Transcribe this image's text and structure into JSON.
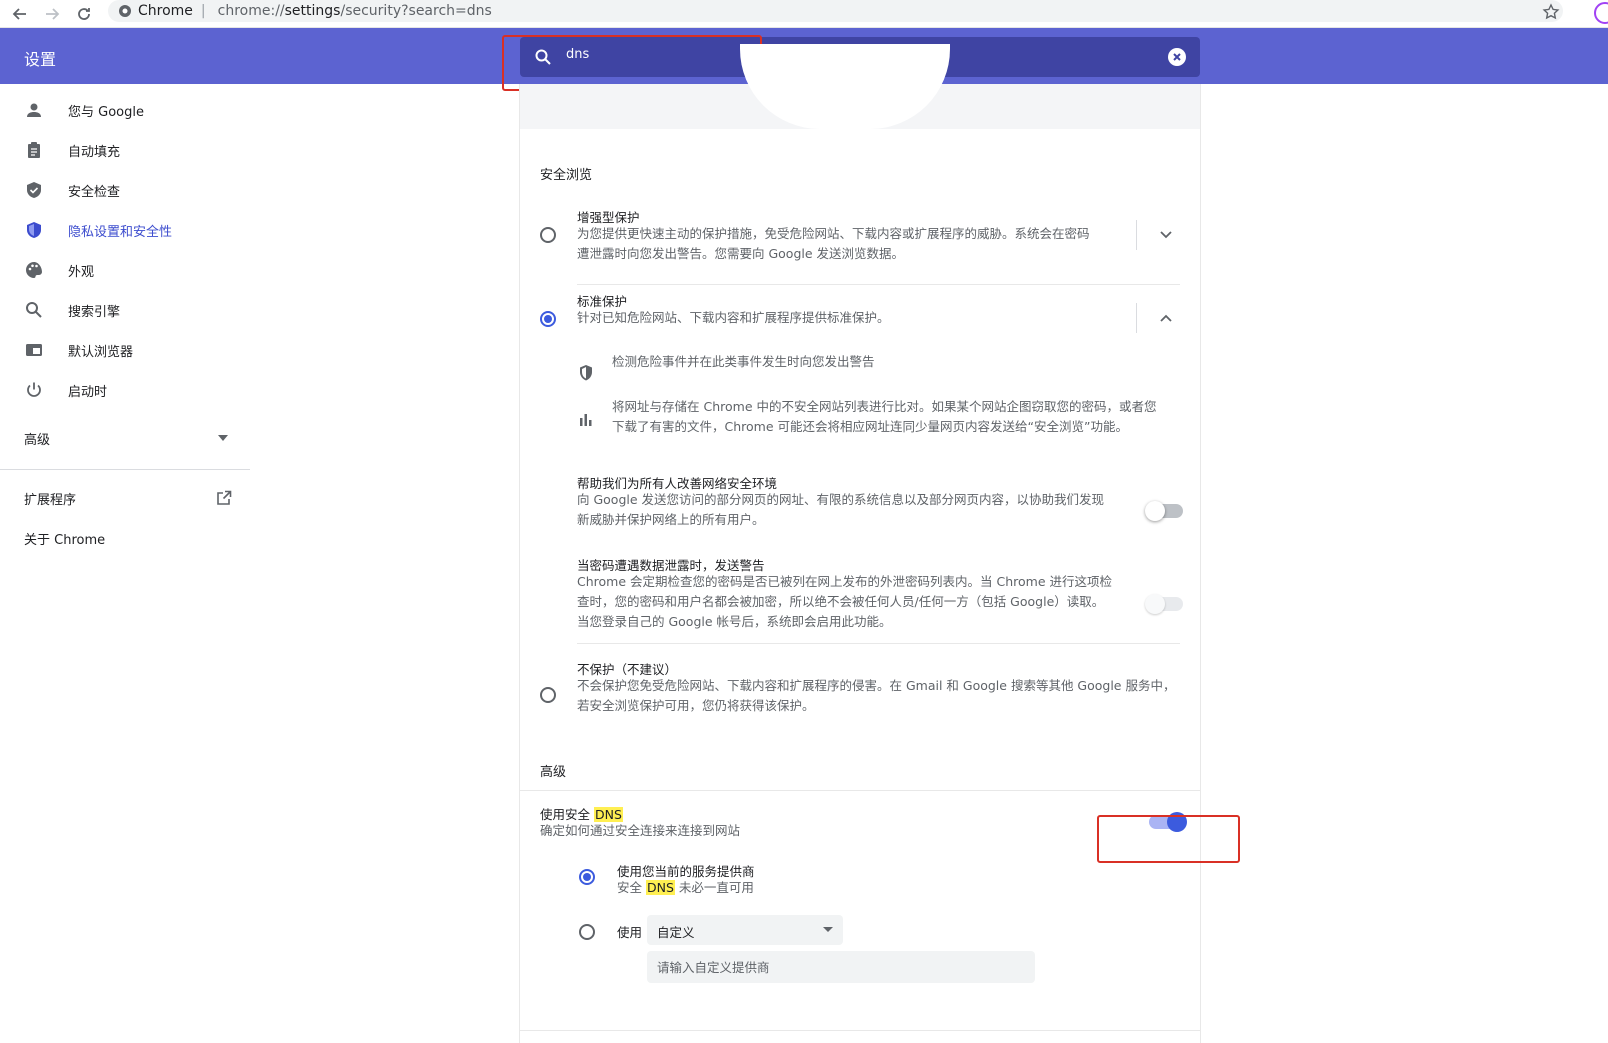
{
  "browser": {
    "site_label": "Chrome",
    "separator": "|",
    "url_prefix": "chrome://",
    "url_bold": "settings",
    "url_suffix": "/security?search=dns"
  },
  "header": {
    "title": "设置",
    "search_value": "dns"
  },
  "sidebar": {
    "items": [
      {
        "label": "您与 Google",
        "icon": "person-icon"
      },
      {
        "label": "自动填充",
        "icon": "clipboard-icon"
      },
      {
        "label": "安全检查",
        "icon": "shield-check-icon"
      },
      {
        "label": "隐私设置和安全性",
        "icon": "shield-privacy-icon",
        "active": true
      },
      {
        "label": "外观",
        "icon": "palette-icon"
      },
      {
        "label": "搜索引擎",
        "icon": "search-icon"
      },
      {
        "label": "默认浏览器",
        "icon": "browser-icon"
      },
      {
        "label": "启动时",
        "icon": "power-icon"
      }
    ],
    "advanced_label": "高级",
    "extensions_label": "扩展程序",
    "about_label": "关于 Chrome"
  },
  "safe_browsing": {
    "section_title": "安全浏览",
    "enhanced": {
      "title": "增强型保护",
      "desc_line1": "为您提供更快速主动的保护措施，免受危险网站、下载内容或扩展程序的威胁。系统会在密码",
      "desc_line2": "遭泄露时向您发出警告。您需要向 Google 发送浏览数据。"
    },
    "standard": {
      "title": "标准保护",
      "desc": "针对已知危险网站、下载内容和扩展程序提供标准保护。",
      "feature1": "检测危险事件并在此类事件发生时向您发出警告",
      "feature2_line1": "将网址与存储在 Chrome 中的不安全网站列表进行比对。如果某个网站企图窃取您的密码，或者您",
      "feature2_line2": "下载了有害的文件，Chrome 可能还会将相应网址连同少量网页内容发送给“安全浏览”功能。"
    },
    "help_improve": {
      "title": "帮助我们为所有人改善网络安全环境",
      "desc_line1": "向 Google 发送您访问的部分网页的网址、有限的系统信息以及部分网页内容，以协助我们发现",
      "desc_line2": "新威胁并保护网络上的所有用户。"
    },
    "password_warn": {
      "title": "当密码遭遇数据泄露时，发送警告",
      "desc_line1": "Chrome 会定期检查您的密码是否已被列在网上发布的外泄密码列表内。当 Chrome 进行这项检",
      "desc_line2": "查时，您的密码和用户名都会被加密，所以绝不会被任何人员/任何一方（包括 Google）读取。",
      "desc_line3": "当您登录自己的 Google 帐号后，系统即会启用此功能。"
    },
    "no_protection": {
      "title": "不保护（不建议）",
      "desc_line1": "不会保护您免受危险网站、下载内容和扩展程序的侵害。在 Gmail 和 Google 搜索等其他 Google 服务中，",
      "desc_line2": "若安全浏览保护可用，您仍将获得该保护。"
    }
  },
  "advanced": {
    "section_title": "高级",
    "secure_dns": {
      "title_prefix": "使用安全 ",
      "title_highlight": "DNS",
      "desc": "确定如何通过安全连接来连接到网站",
      "enabled": true
    },
    "current_provider": {
      "title": "使用您当前的服务提供商",
      "desc_prefix": "安全 ",
      "desc_highlight": "DNS",
      "desc_suffix": " 未必一直可用"
    },
    "custom": {
      "label": "使用",
      "selected": "自定义",
      "input_placeholder": "请输入自定义提供商"
    }
  },
  "colors": {
    "header_bg": "#5c63d1",
    "accent": "#3c5bde",
    "highlight": "#ffef52",
    "annotation_red": "#d93025"
  }
}
